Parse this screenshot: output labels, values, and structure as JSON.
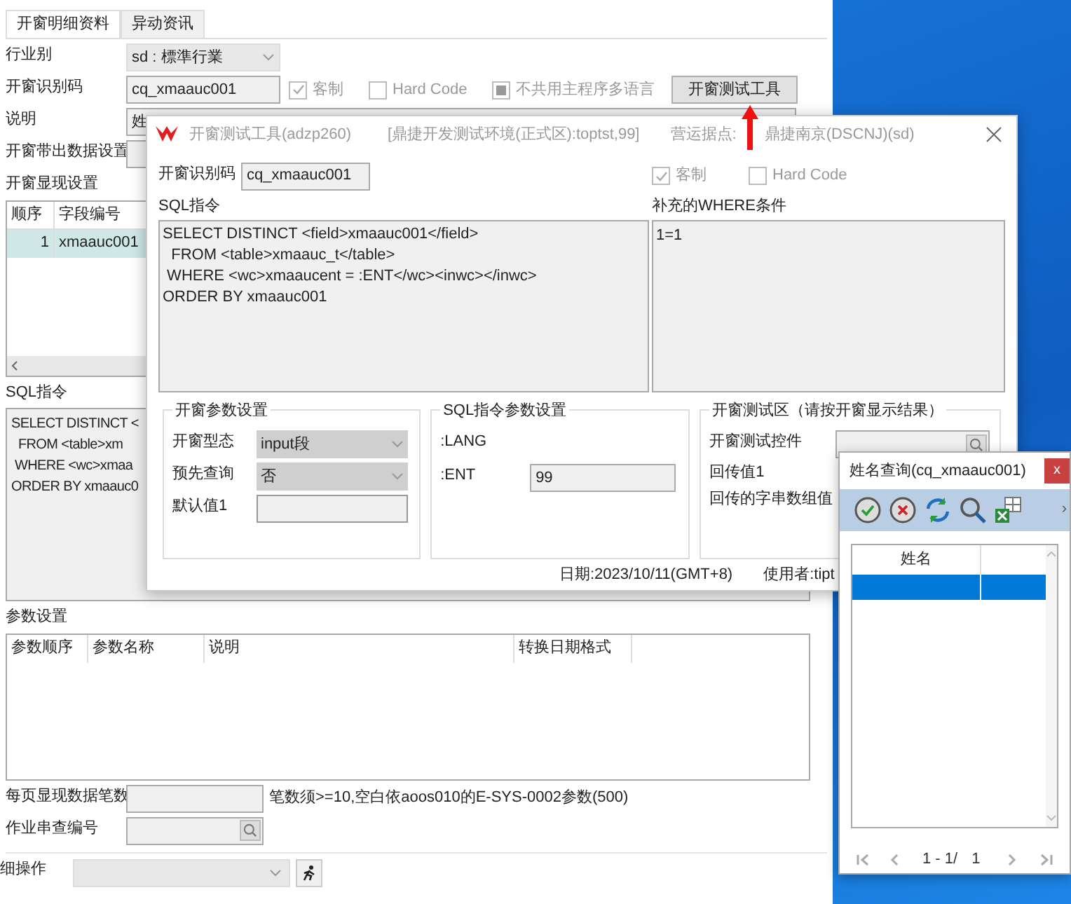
{
  "main_window": {
    "tabs": [
      {
        "label": "开窗明细资料",
        "selected": true
      },
      {
        "label": "异动资讯",
        "selected": false
      }
    ],
    "industry": {
      "label": "行业别",
      "value": "sd : 標準行業"
    },
    "window_code": {
      "label": "开窗识别码",
      "value": "cq_xmaauc001"
    },
    "checkboxes": [
      {
        "label": "客制",
        "checked": true,
        "indeterminate": false,
        "disabled": true
      },
      {
        "label": "Hard Code",
        "checked": false,
        "indeterminate": false,
        "disabled": true
      },
      {
        "label": "不共用主程序多语言",
        "checked": false,
        "indeterminate": true,
        "disabled": true
      }
    ],
    "test_button": "开窗测试工具",
    "description": {
      "label": "说明",
      "value": "姓"
    },
    "output_settings": {
      "label": "开窗带出数据设置"
    },
    "display_settings": {
      "label": "开窗显现设置",
      "columns": [
        "顺序",
        "字段编号"
      ],
      "rows": [
        {
          "cells": [
            "1",
            "xmaauc001"
          ],
          "selected": true
        }
      ]
    },
    "sql": {
      "label": "SQL指令",
      "lines": [
        "SELECT DISTINCT <",
        "  FROM <table>xm",
        " WHERE <wc>xmaa",
        "ORDER BY xmaauc0"
      ]
    },
    "params": {
      "label": "参数设置",
      "columns": [
        "参数顺序",
        "参数名称",
        "说明",
        "转换日期格式"
      ]
    },
    "page_size": {
      "label": "每页显现数据笔数",
      "note": "笔数须>=10,空白依aoos010的E-SYS-0002参数(500)"
    },
    "job_link": {
      "label": "作业串查编号"
    },
    "detail_op": {
      "label": "细操作"
    }
  },
  "test_dialog": {
    "title": "开窗测试工具(adzp260)",
    "env": "[鼎捷开发测试环境(正式区):toptst,99]",
    "site": "营运据点:",
    "site_value": "鼎捷南京(DSCNJ)(sd)",
    "window_code": {
      "label": "开窗识别码",
      "value": "cq_xmaauc001"
    },
    "checkboxes": [
      {
        "label": "客制",
        "checked": true,
        "disabled": true
      },
      {
        "label": "Hard Code",
        "checked": false,
        "disabled": true
      }
    ],
    "sql": {
      "label": "SQL指令",
      "lines": [
        "SELECT DISTINCT <field>xmaauc001</field>",
        "  FROM <table>xmaauc_t</table>",
        " WHERE <wc>xmaaucent = :ENT</wc><inwc></inwc>",
        "ORDER BY xmaauc001"
      ]
    },
    "where": {
      "label": "补充的WHERE条件",
      "value": "1=1"
    },
    "window_params": {
      "title": "开窗参数设置",
      "type": {
        "label": "开窗型态",
        "value": "input段"
      },
      "prequery": {
        "label": "预先查询",
        "value": "否"
      },
      "default1": {
        "label": "默认值1"
      }
    },
    "sql_params": {
      "title": "SQL指令参数设置",
      "params": [
        {
          "name": ":LANG"
        },
        {
          "name": ":ENT",
          "value": "99"
        }
      ]
    },
    "test_area": {
      "title": "开窗测试区（请按开窗显示结果）",
      "control": {
        "label": "开窗测试控件"
      },
      "return1": "回传值1",
      "return_array": "回传的字串数组值"
    },
    "status": {
      "date": "日期:2023/10/11(GMT+8)",
      "user": "使用者:tipt"
    }
  },
  "name_dialog": {
    "title": "姓名查询(cq_xmaauc001)",
    "close": "x",
    "more": "›",
    "columns": [
      "姓名"
    ],
    "rows": [
      {
        "selected": true
      }
    ],
    "pager": {
      "range": "1 - 1/",
      "total": "1"
    }
  }
}
